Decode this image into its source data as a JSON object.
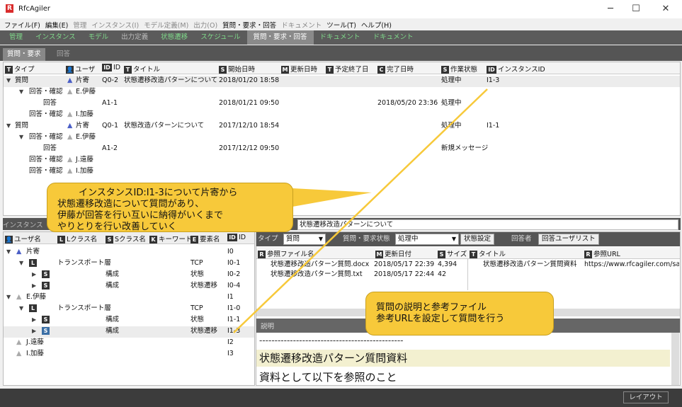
{
  "window": {
    "title": "RfcAgiler",
    "app_letter": "R",
    "min": "─",
    "max": "☐",
    "close": "✕"
  },
  "menu": [
    "ファイル(F)",
    "編集(E)",
    "管理",
    "インスタンス(I)",
    "モデル定義(M)",
    "出力(O)",
    "質問・要求・回答",
    "ドキュメント",
    "ツール(T)",
    "ヘルプ(H)"
  ],
  "tabs": [
    "管理",
    "インスタンス",
    "モデル",
    "出力定義",
    "状態遷移",
    "スケジュール",
    "質問・要求・回答",
    "ドキュメント",
    "ドキュメント"
  ],
  "subtabs": [
    "質問・要求",
    "回答"
  ],
  "tree_headers": {
    "type": "タイプ",
    "user": "ユーザ",
    "id": "ID",
    "title": "タイトル",
    "start": "開始日時",
    "updated": "更新日時",
    "due": "予定終了日",
    "done": "完了日時",
    "state": "作業状態",
    "instance": "インスタンスID"
  },
  "tree_rows": [
    {
      "type": "質問",
      "user": "片寄",
      "id": "Q0-2",
      "title": "状態遷移改造パターンについて",
      "start": "2018/01/20 18:58",
      "done": "",
      "state": "処理中",
      "instance": "I1-3"
    },
    {
      "type": "回答・確認",
      "user": "E.伊藤",
      "id": "",
      "title": "",
      "start": "",
      "done": "",
      "state": "",
      "instance": ""
    },
    {
      "type": "回答",
      "user": "",
      "id": "A1-1",
      "title": "",
      "start": "2018/01/21 09:50",
      "done": "2018/05/20 23:36",
      "state": "処理中",
      "instance": ""
    },
    {
      "type": "回答・確認",
      "user": "I.加藤",
      "id": "",
      "title": "",
      "start": "",
      "done": "",
      "state": "",
      "instance": ""
    },
    {
      "type": "質問",
      "user": "片寄",
      "id": "Q0-1",
      "title": "状態改造パターンについて",
      "start": "2017/12/10 18:54",
      "done": "",
      "state": "処理中",
      "instance": "I1-1"
    },
    {
      "type": "回答・確認",
      "user": "E.伊藤",
      "id": "",
      "title": "",
      "start": "",
      "done": "",
      "state": "",
      "instance": ""
    },
    {
      "type": "回答",
      "user": "",
      "id": "A1-2",
      "title": "",
      "start": "2017/12/12 09:50",
      "done": "",
      "state": "新規メッセージ",
      "instance": ""
    },
    {
      "type": "回答・確認",
      "user": "J.遠藤",
      "id": "",
      "title": "",
      "start": "",
      "done": "",
      "state": "",
      "instance": ""
    },
    {
      "type": "回答・確認",
      "user": "I.加藤",
      "id": "",
      "title": "",
      "start": "",
      "done": "",
      "state": "",
      "instance": ""
    }
  ],
  "callout1": [
    "インスタンスID:I1-3について片寄から",
    "状態遷移改造について質問があり、",
    "伊藤が回答を行い互いに納得がいくまで",
    "やりとりを行い改善していく"
  ],
  "callout2": [
    "質問の説明と参考ファイル",
    "参考URLを設定して質問を行う"
  ],
  "lower": {
    "tab": "インスタンス",
    "title_value": "状態遷移改造パターンについて"
  },
  "inst_headers": {
    "user": "ユーザ名",
    "lclass": "Lクラス名",
    "sclass": "Sクラス名",
    "keyword": "キーワード",
    "elem": "要素名",
    "id": "ID"
  },
  "inst_rows": [
    {
      "name": "片寄",
      "lclass": "",
      "sclass": "",
      "elem": "",
      "id": "I0"
    },
    {
      "name": "",
      "lclass": "トランスポート層",
      "sclass": "",
      "elem": "TCP",
      "id": "I0-1"
    },
    {
      "name": "",
      "lclass": "",
      "sclass": "構成",
      "elem": "状態",
      "id": "I0-2"
    },
    {
      "name": "",
      "lclass": "",
      "sclass": "構成",
      "elem": "状態遷移",
      "id": "I0-4"
    },
    {
      "name": "E.伊藤",
      "lclass": "",
      "sclass": "",
      "elem": "",
      "id": "I1"
    },
    {
      "name": "",
      "lclass": "トランスポート層",
      "sclass": "",
      "elem": "TCP",
      "id": "I1-0"
    },
    {
      "name": "",
      "lclass": "",
      "sclass": "構成",
      "elem": "状態",
      "id": "I1-1"
    },
    {
      "name": "",
      "lclass": "",
      "sclass": "構成",
      "elem": "状態遷移",
      "id": "I1-3"
    },
    {
      "name": "J.遠藤",
      "lclass": "",
      "sclass": "",
      "elem": "",
      "id": "I2"
    },
    {
      "name": "I.加藤",
      "lclass": "",
      "sclass": "",
      "elem": "",
      "id": "I3"
    }
  ],
  "toolbar": {
    "type_label": "タイプ",
    "type_value": "質問",
    "state_label": "質問・要求状態",
    "state_value": "処理中",
    "state_btn": "状態設定",
    "answerer": "回答者",
    "answer_users": "回答ユーザリスト"
  },
  "file_headers": {
    "name": "参照ファイル名",
    "updated": "更新日付",
    "size": "サイズ",
    "title": "タイトル",
    "url": "参照URL"
  },
  "files": [
    {
      "name": "状態遷移改造パターン質問.docx",
      "updated": "2018/05/17 22:39",
      "size": "4,394",
      "title": "状態遷移改造パターン質問資料",
      "url": "https://www.rfcagiler.com/sa"
    },
    {
      "name": "状態遷移改造パターン質問.txt",
      "updated": "2018/05/17 22:44",
      "size": "42",
      "title": "",
      "url": ""
    }
  ],
  "desc": {
    "tab": "説明",
    "line0": "-----------------------------------------------",
    "line1": "状態遷移改造パターン質問資料",
    "line2": "資料として以下を参照のこと"
  },
  "status": {
    "layout": "レイアウト"
  },
  "colors": {
    "callout": "#f7c93a",
    "header_dark": "#555555",
    "highlight": "#f3f0d0"
  }
}
